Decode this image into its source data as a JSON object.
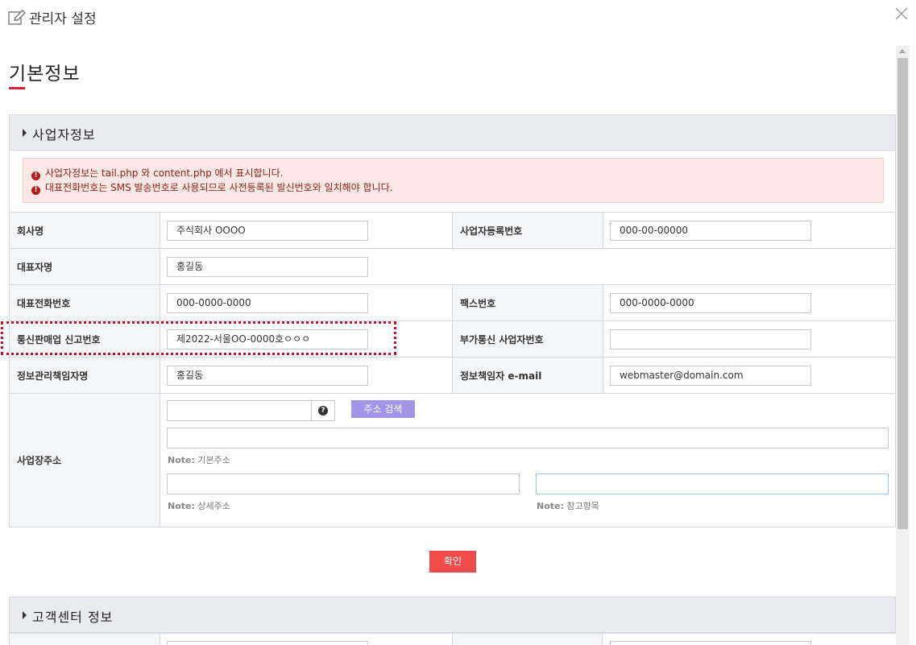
{
  "window": {
    "title": "관리자 설정",
    "page_heading": "기본정보"
  },
  "business_section": {
    "title": "사업자정보",
    "notices": [
      "사업자정보는 tail.php 와 content.php 에서 표시합니다.",
      "대표전화번호는 SMS 발송번호로 사용되므로 사전등록된 발신번호와 일치해야 합니다."
    ],
    "fields": {
      "company_name": {
        "label": "회사명",
        "value": "주식회사 OOOO"
      },
      "business_reg_no": {
        "label": "사업자등록번호",
        "value": "000-00-00000"
      },
      "ceo_name": {
        "label": "대표자명",
        "value": "홍길동"
      },
      "main_phone": {
        "label": "대표전화번호",
        "value": "000-0000-0000"
      },
      "fax": {
        "label": "팩스번호",
        "value": "000-0000-0000"
      },
      "ecommerce_no": {
        "label": "통신판매업 신고번호",
        "value": "제2022-서울OO-0000호ㅇㅇㅇ"
      },
      "vat_no": {
        "label": "부가통신 사업자번호",
        "value": ""
      },
      "privacy_officer": {
        "label": "정보관리책임자명",
        "value": "홍길동"
      },
      "privacy_email": {
        "label": "정보책임자 e-mail",
        "value": "webmaster@domain.com"
      }
    },
    "address": {
      "label": "사업장주소",
      "search_button": "주소 검색",
      "note_prefix": "Note:",
      "note_basic": "기본주소",
      "note_detail": "상세주소",
      "note_extra": "참고항목"
    },
    "confirm_button": "확인"
  },
  "customer_section": {
    "title": "고객센터 정보"
  },
  "colors": {
    "accent_red": "#e61d3c",
    "confirm_button": "#f04b4b",
    "search_button": "#a394e8",
    "notice_bg": "#fbe7e6",
    "notice_text": "#8b1e1e",
    "highlight_border": "#c8102e"
  }
}
